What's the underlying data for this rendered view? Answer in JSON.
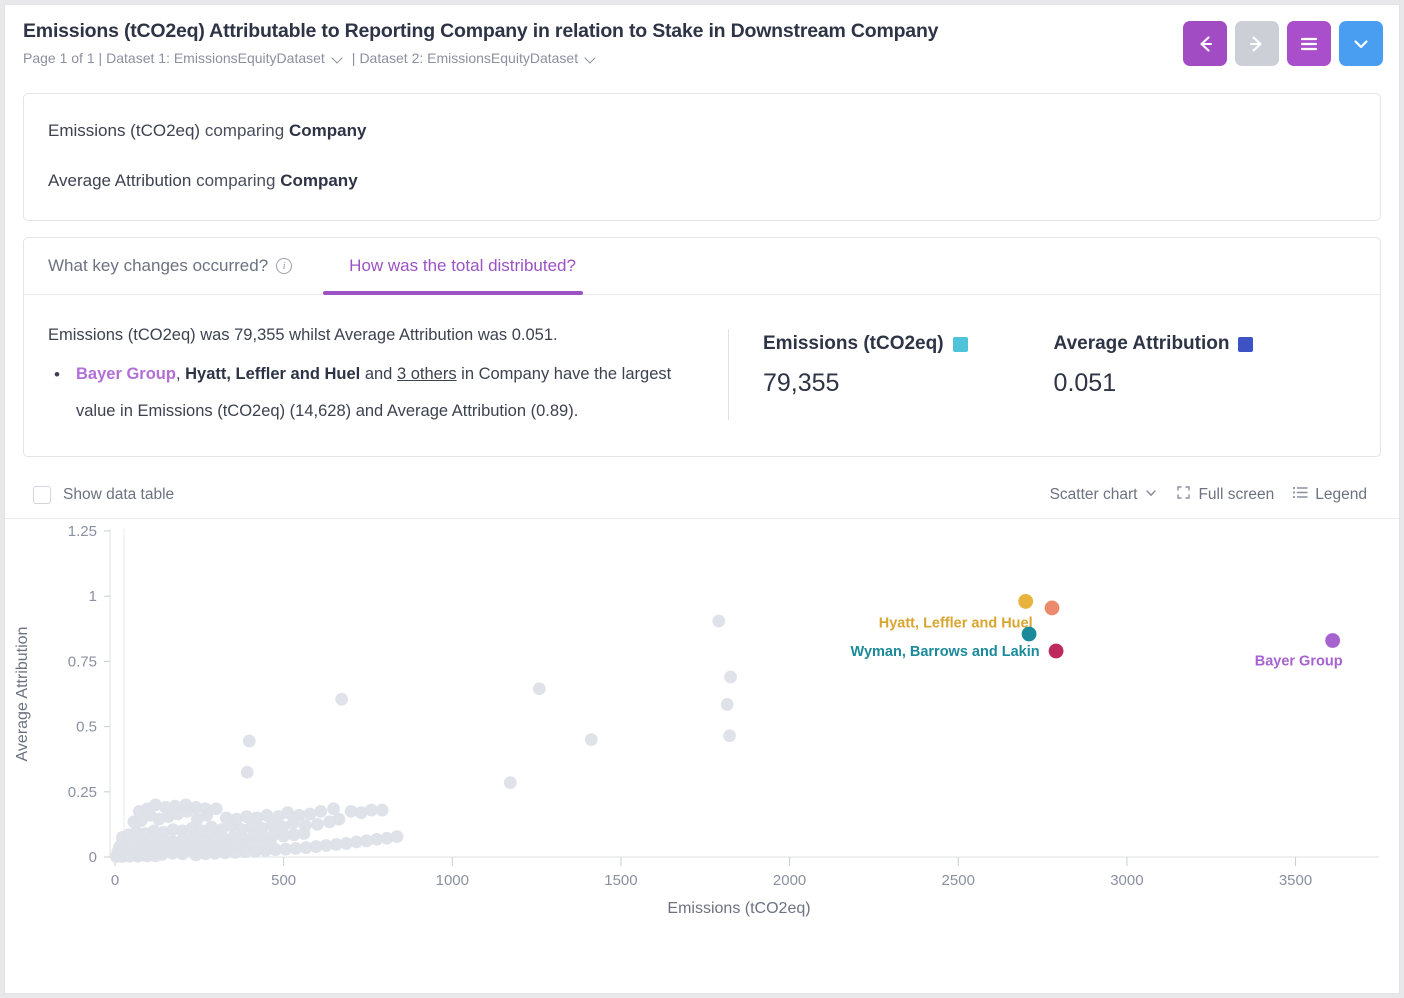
{
  "header": {
    "title": "Emissions (tCO2eq) Attributable to Reporting Company in relation to Stake in Downstream Company",
    "page_label": "Page 1 of 1 |",
    "dataset1_label": "Dataset 1: EmissionsEquityDataset",
    "separator": "|",
    "dataset2_label": "Dataset 2: EmissionsEquityDataset",
    "buttons": {
      "back": {
        "name": "back-button",
        "color": "#a24cc4"
      },
      "forward": {
        "name": "forward-button",
        "color": "#ccd0d6"
      },
      "menu": {
        "name": "menu-button",
        "color": "#a94fcb"
      },
      "expand": {
        "name": "expand-button",
        "color": "#4a9ef2"
      }
    }
  },
  "comparison": {
    "rows": [
      {
        "measure": "Emissions (tCO2eq)",
        "connector": "comparing",
        "dimension": "Company"
      },
      {
        "measure": "Average Attribution",
        "connector": "comparing",
        "dimension": "Company"
      }
    ]
  },
  "tabs": [
    {
      "label": "What key changes occurred?",
      "active": false,
      "has_info_icon": true
    },
    {
      "label": "How was the total distributed?",
      "active": true,
      "has_info_icon": false
    }
  ],
  "insight": {
    "summary": "Emissions (tCO2eq) was 79,355 whilst Average Attribution was 0.051.",
    "bullet_marker": "•",
    "bullet": {
      "part1": "Bayer Group",
      "part2": ", ",
      "part3": "Hyatt, Leffler and Huel",
      "part4": " and ",
      "part5": "3 others",
      "part6": " in Company have the largest value in Emissions (tCO2eq) (14,628) and Average Attribution (0.89)."
    }
  },
  "kpis": [
    {
      "label": "Emissions (tCO2eq)",
      "value": "79,355",
      "color": "#4ec3d9"
    },
    {
      "label": "Average Attribution",
      "value": "0.051",
      "color": "#3d52c4"
    }
  ],
  "chart_toolbar": {
    "show_data_table": "Show data table",
    "checked": false,
    "chart_type": "Scatter chart",
    "full_screen": "Full screen",
    "legend": "Legend"
  },
  "chart_data": {
    "type": "scatter",
    "title": "",
    "xlabel": "Emissions (tCO2eq)",
    "ylabel": "Average Attribution",
    "xlim": [
      0,
      3700
    ],
    "ylim": [
      0,
      1.25
    ],
    "xticks": [
      0,
      500,
      1000,
      1500,
      2000,
      2500,
      3000,
      3500
    ],
    "xtick_labels": [
      "0",
      "500",
      "1000",
      "1500",
      "2000",
      "2500",
      "3000",
      "3500"
    ],
    "yticks": [
      0,
      0.25,
      0.5,
      0.75,
      1,
      1.25
    ],
    "ytick_labels": [
      "0",
      "0.25",
      "0.5",
      "0.75",
      "1",
      "1.25"
    ],
    "grid": false,
    "legend_position": "none",
    "default_point_color": "#dde2e8",
    "highlighted": [
      {
        "label": "Hyatt, Leffler and Huel",
        "x": 2700,
        "y": 0.98,
        "color": "#e8b33d",
        "label_color": "#d9a52f",
        "label_dx": -70,
        "label_dy": 26
      },
      {
        "label": "",
        "x": 2778,
        "y": 0.955,
        "color": "#ec8a6e",
        "label_color": "#ec8a6e",
        "label_dx": 0,
        "label_dy": 0
      },
      {
        "label": "Wyman, Barrows and Lakin",
        "x": 2710,
        "y": 0.855,
        "color": "#1b8a9a",
        "label_color": "#1b8a9a",
        "label_dx": -84,
        "label_dy": 22
      },
      {
        "label": "",
        "x": 2790,
        "y": 0.79,
        "color": "#bf2a5e",
        "label_color": "#bf2a5e",
        "label_dx": 0,
        "label_dy": 0
      },
      {
        "label": "Bayer Group",
        "x": 3610,
        "y": 0.83,
        "color": "#a663cf",
        "label_color": "#a663cf",
        "label_dx": -34,
        "label_dy": 25
      }
    ],
    "points": [
      [
        1790,
        0.905
      ],
      [
        1825,
        0.69
      ],
      [
        1815,
        0.585
      ],
      [
        1822,
        0.465
      ],
      [
        1258,
        0.645
      ],
      [
        1412,
        0.45
      ],
      [
        1172,
        0.285
      ],
      [
        672,
        0.605
      ],
      [
        398,
        0.445
      ],
      [
        392,
        0.325
      ],
      [
        760,
        0.18
      ],
      [
        792,
        0.18
      ],
      [
        648,
        0.185
      ],
      [
        610,
        0.175
      ],
      [
        578,
        0.165
      ],
      [
        546,
        0.16
      ],
      [
        512,
        0.17
      ],
      [
        484,
        0.155
      ],
      [
        450,
        0.16
      ],
      [
        420,
        0.15
      ],
      [
        390,
        0.155
      ],
      [
        360,
        0.145
      ],
      [
        330,
        0.15
      ],
      [
        300,
        0.185
      ],
      [
        272,
        0.16
      ],
      [
        244,
        0.145
      ],
      [
        214,
        0.175
      ],
      [
        186,
        0.165
      ],
      [
        158,
        0.155
      ],
      [
        130,
        0.145
      ],
      [
        104,
        0.16
      ],
      [
        78,
        0.14
      ],
      [
        56,
        0.135
      ],
      [
        700,
        0.175
      ],
      [
        730,
        0.17
      ],
      [
        664,
        0.145
      ],
      [
        636,
        0.135
      ],
      [
        600,
        0.125
      ],
      [
        564,
        0.12
      ],
      [
        528,
        0.13
      ],
      [
        498,
        0.115
      ],
      [
        466,
        0.125
      ],
      [
        436,
        0.11
      ],
      [
        404,
        0.115
      ],
      [
        376,
        0.105
      ],
      [
        346,
        0.12
      ],
      [
        316,
        0.105
      ],
      [
        286,
        0.115
      ],
      [
        258,
        0.1
      ],
      [
        228,
        0.11
      ],
      [
        200,
        0.1
      ],
      [
        172,
        0.105
      ],
      [
        144,
        0.095
      ],
      [
        116,
        0.1
      ],
      [
        90,
        0.09
      ],
      [
        64,
        0.095
      ],
      [
        40,
        0.085
      ],
      [
        22,
        0.075
      ],
      [
        560,
        0.09
      ],
      [
        530,
        0.085
      ],
      [
        500,
        0.08
      ],
      [
        470,
        0.085
      ],
      [
        440,
        0.075
      ],
      [
        410,
        0.08
      ],
      [
        380,
        0.07
      ],
      [
        350,
        0.075
      ],
      [
        320,
        0.07
      ],
      [
        290,
        0.075
      ],
      [
        260,
        0.065
      ],
      [
        230,
        0.07
      ],
      [
        200,
        0.065
      ],
      [
        170,
        0.06
      ],
      [
        140,
        0.065
      ],
      [
        110,
        0.06
      ],
      [
        82,
        0.055
      ],
      [
        54,
        0.06
      ],
      [
        28,
        0.05
      ],
      [
        14,
        0.04
      ],
      [
        460,
        0.055
      ],
      [
        430,
        0.05
      ],
      [
        400,
        0.055
      ],
      [
        370,
        0.045
      ],
      [
        340,
        0.05
      ],
      [
        310,
        0.045
      ],
      [
        280,
        0.05
      ],
      [
        250,
        0.04
      ],
      [
        220,
        0.045
      ],
      [
        190,
        0.04
      ],
      [
        160,
        0.045
      ],
      [
        130,
        0.035
      ],
      [
        100,
        0.04
      ],
      [
        70,
        0.035
      ],
      [
        44,
        0.03
      ],
      [
        20,
        0.025
      ],
      [
        8,
        0.02
      ],
      [
        340,
        0.03
      ],
      [
        310,
        0.028
      ],
      [
        280,
        0.03
      ],
      [
        250,
        0.025
      ],
      [
        220,
        0.028
      ],
      [
        190,
        0.022
      ],
      [
        160,
        0.025
      ],
      [
        130,
        0.02
      ],
      [
        100,
        0.022
      ],
      [
        74,
        0.018
      ],
      [
        48,
        0.015
      ],
      [
        26,
        0.012
      ],
      [
        10,
        0.008
      ],
      [
        200,
        0.012
      ],
      [
        170,
        0.014
      ],
      [
        140,
        0.01
      ],
      [
        112,
        0.012
      ],
      [
        86,
        0.008
      ],
      [
        60,
        0.01
      ],
      [
        36,
        0.006
      ],
      [
        16,
        0.005
      ],
      [
        6,
        0.004
      ],
      [
        120,
        0.005
      ],
      [
        96,
        0.004
      ],
      [
        68,
        0.003
      ],
      [
        44,
        0.003
      ],
      [
        22,
        0.002
      ],
      [
        4,
        0.002
      ],
      [
        240,
        0.008
      ],
      [
        268,
        0.012
      ],
      [
        296,
        0.014
      ],
      [
        326,
        0.016
      ],
      [
        356,
        0.018
      ],
      [
        386,
        0.02
      ],
      [
        416,
        0.022
      ],
      [
        446,
        0.025
      ],
      [
        476,
        0.028
      ],
      [
        506,
        0.03
      ],
      [
        536,
        0.033
      ],
      [
        566,
        0.036
      ],
      [
        596,
        0.04
      ],
      [
        626,
        0.044
      ],
      [
        656,
        0.048
      ],
      [
        686,
        0.052
      ],
      [
        716,
        0.058
      ],
      [
        746,
        0.062
      ],
      [
        776,
        0.068
      ],
      [
        806,
        0.072
      ],
      [
        836,
        0.078
      ],
      [
        150,
        0.19
      ],
      [
        178,
        0.195
      ],
      [
        210,
        0.2
      ],
      [
        240,
        0.19
      ],
      [
        268,
        0.185
      ],
      [
        120,
        0.2
      ],
      [
        96,
        0.185
      ],
      [
        72,
        0.175
      ]
    ]
  }
}
